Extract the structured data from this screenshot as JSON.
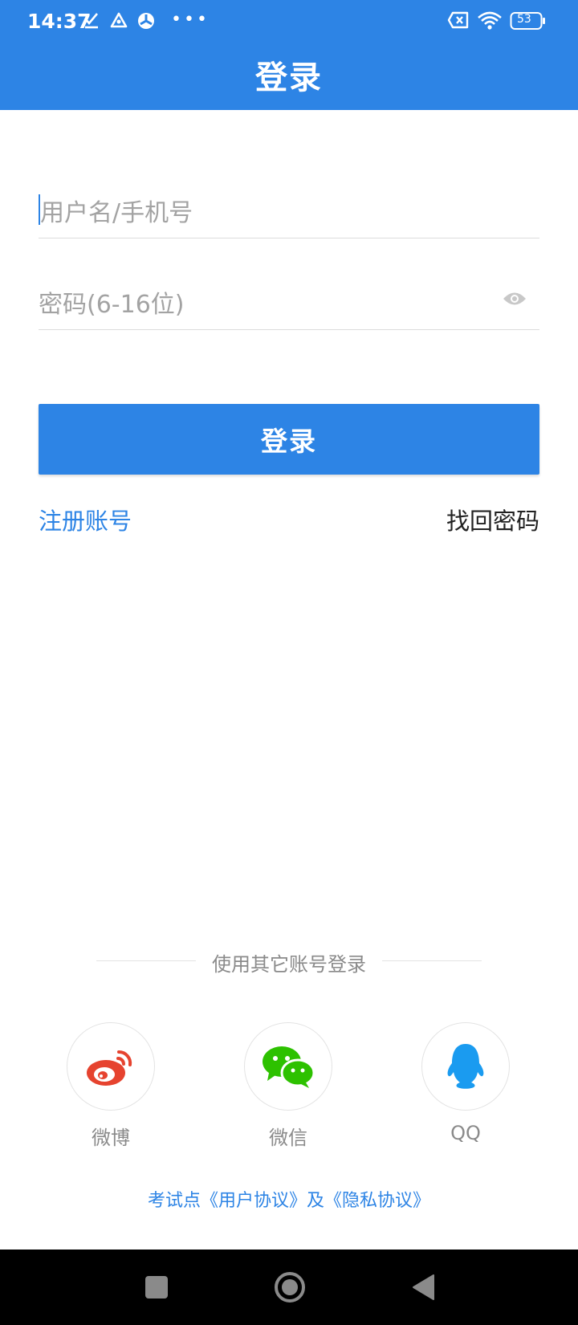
{
  "status_bar": {
    "time": "14:37",
    "battery": "53",
    "icons": [
      "check-icon",
      "delta-icon",
      "sync-icon",
      "more-icon",
      "sim-off-icon",
      "wifi-icon",
      "battery-icon"
    ]
  },
  "header": {
    "title": "登录"
  },
  "form": {
    "username_placeholder": "用户名/手机号",
    "password_placeholder": "密码(6-16位)",
    "login_button": "登录"
  },
  "links": {
    "register": "注册账号",
    "forgot": "找回密码"
  },
  "other_login": {
    "label": "使用其它账号登录",
    "providers": [
      {
        "name": "微博",
        "icon": "weibo-icon",
        "color": "#E6432F"
      },
      {
        "name": "微信",
        "icon": "wechat-icon",
        "color": "#2DC100"
      },
      {
        "name": "QQ",
        "icon": "qq-icon",
        "color": "#1A9BF0"
      }
    ]
  },
  "agreement": "考试点《用户协议》及《隐私协议》",
  "colors": {
    "primary": "#2D84E5",
    "link": "#2D84E5",
    "hint": "#a3a3a3"
  }
}
